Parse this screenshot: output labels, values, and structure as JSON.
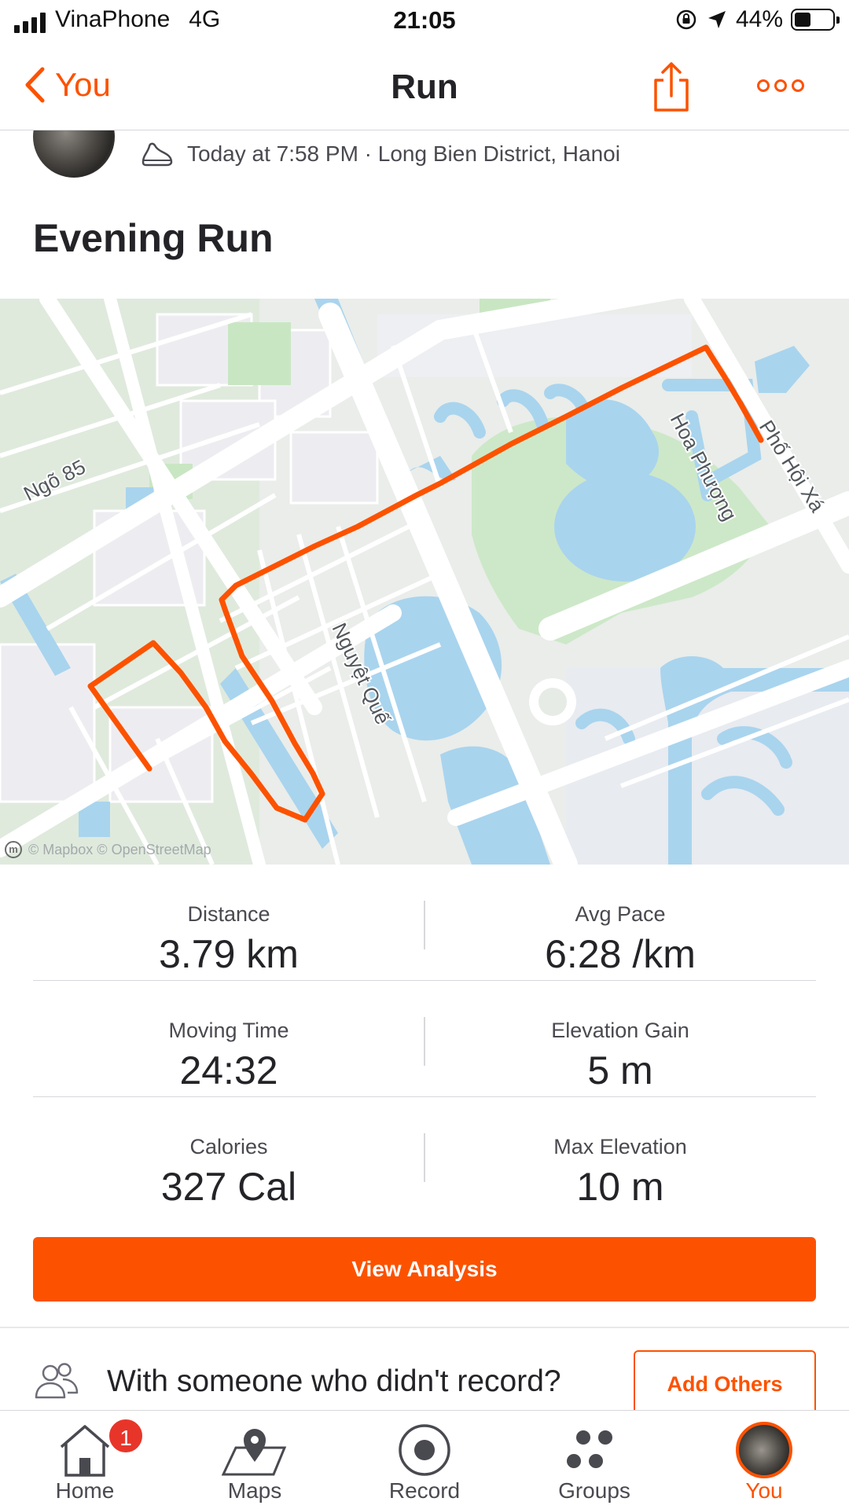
{
  "status_bar": {
    "carrier": "VinaPhone",
    "network": "4G",
    "time": "21:05",
    "battery": "44%",
    "battery_level": 0.44
  },
  "nav": {
    "back_label": "You",
    "title": "Run"
  },
  "activity": {
    "meta": "Today at 7:58 PM · Long Bien District, Hanoi",
    "title": "Evening Run"
  },
  "map": {
    "labels": {
      "ngo85": "Ngõ 85",
      "hoa_phuong": "Hoa Phượng",
      "pho_hoi_xa": "Phố Hội Xá",
      "nguyet_que": "Nguyệt Quế"
    },
    "attribution": "© Mapbox © OpenStreetMap",
    "route_color": "#fc5200"
  },
  "stats": [
    {
      "left_label": "Distance",
      "left_value": "3.79 km",
      "right_label": "Avg Pace",
      "right_value": "6:28 /km"
    },
    {
      "left_label": "Moving Time",
      "left_value": "24:32",
      "right_label": "Elevation Gain",
      "right_value": "5 m"
    },
    {
      "left_label": "Calories",
      "left_value": "327 Cal",
      "right_label": "Max Elevation",
      "right_value": "10 m"
    }
  ],
  "buttons": {
    "view_analysis": "View Analysis",
    "add_others": "Add Others"
  },
  "with_others": {
    "text": "With someone who didn't record?"
  },
  "tabs": [
    {
      "label": "Home",
      "icon": "home-icon",
      "badge": "1"
    },
    {
      "label": "Maps",
      "icon": "maps-icon"
    },
    {
      "label": "Record",
      "icon": "record-icon"
    },
    {
      "label": "Groups",
      "icon": "groups-icon"
    },
    {
      "label": "You",
      "icon": "avatar",
      "active": true
    }
  ],
  "colors": {
    "accent": "#fc5200",
    "badge": "#e8352a",
    "water": "#a9d4ee",
    "park": "#cde8c8"
  }
}
